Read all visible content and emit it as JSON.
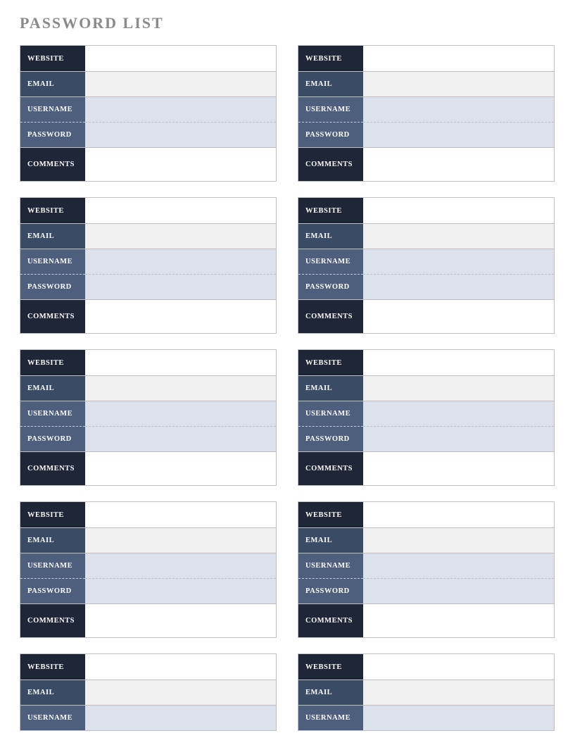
{
  "title": "PASSWORD LIST",
  "labels": {
    "website": "WEBSITE",
    "email": "EMAIL",
    "username": "USERNAME",
    "password": "PASSWORD",
    "comments": "COMMENTS"
  },
  "cards": [
    {
      "full": true,
      "website": "",
      "email": "",
      "username": "",
      "password": "",
      "comments": ""
    },
    {
      "full": true,
      "website": "",
      "email": "",
      "username": "",
      "password": "",
      "comments": ""
    },
    {
      "full": true,
      "website": "",
      "email": "",
      "username": "",
      "password": "",
      "comments": ""
    },
    {
      "full": true,
      "website": "",
      "email": "",
      "username": "",
      "password": "",
      "comments": ""
    },
    {
      "full": true,
      "website": "",
      "email": "",
      "username": "",
      "password": "",
      "comments": ""
    },
    {
      "full": true,
      "website": "",
      "email": "",
      "username": "",
      "password": "",
      "comments": ""
    },
    {
      "full": true,
      "website": "",
      "email": "",
      "username": "",
      "password": "",
      "comments": ""
    },
    {
      "full": true,
      "website": "",
      "email": "",
      "username": "",
      "password": "",
      "comments": ""
    },
    {
      "full": false,
      "website": "",
      "email": "",
      "username": ""
    },
    {
      "full": false,
      "website": "",
      "email": "",
      "username": ""
    }
  ]
}
